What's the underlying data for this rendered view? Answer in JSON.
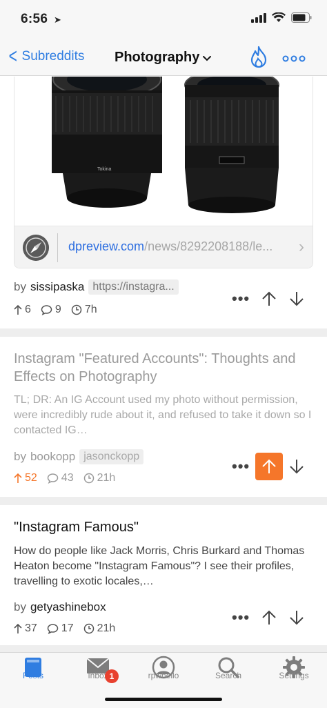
{
  "status_bar": {
    "time": "6:56",
    "location_icon": "location-arrow-icon",
    "signal_icon": "cellular-signal-icon",
    "wifi_icon": "wifi-icon",
    "battery_icon": "battery-icon"
  },
  "nav": {
    "back_label": "Subreddits",
    "title": "Photography",
    "title_icon": "chevron-down-icon",
    "sort_icon": "flame-icon",
    "more_icon": "ellipsis-icon",
    "accent_color": "#2f7de1"
  },
  "link_post": {
    "domain": "dpreview.com",
    "path": "/news/8292208188/le...",
    "author_prefix": "by",
    "author": "sissipaska",
    "flair": "https://instagra...",
    "upvotes": "6",
    "comments": "9",
    "age": "7h"
  },
  "posts": [
    {
      "title": "Instagram \"Featured Accounts\": Thoughts and Effects on Photography",
      "body": "TL; DR: An IG Account used my photo without permission, were incredibly rude about it, and refused to take it down so I contacted IG…",
      "author_prefix": "by",
      "author": "bookopp",
      "flair": "jasonckopp",
      "upvotes": "52",
      "comments": "43",
      "age": "21h",
      "upvoted": true
    },
    {
      "title": "\"Instagram Famous\"",
      "body": "How do people like Jack Morris, Chris Burkard and Thomas Heaton become \"Instagram Famous\"? I see their profiles, travelling to exotic locales,…",
      "author_prefix": "by",
      "author": "getyashinebox",
      "flair": "",
      "upvotes": "37",
      "comments": "17",
      "age": "21h",
      "upvoted": false
    }
  ],
  "tabs": [
    {
      "label": "Posts",
      "icon": "posts-icon"
    },
    {
      "label": "Inbox",
      "icon": "inbox-icon",
      "badge": "1"
    },
    {
      "label": "rpwhello",
      "icon": "profile-icon"
    },
    {
      "label": "Search",
      "icon": "search-icon"
    },
    {
      "label": "Settings",
      "icon": "gear-icon"
    }
  ],
  "colors": {
    "upvote_active": "#f5762a",
    "badge": "#e8412f"
  }
}
